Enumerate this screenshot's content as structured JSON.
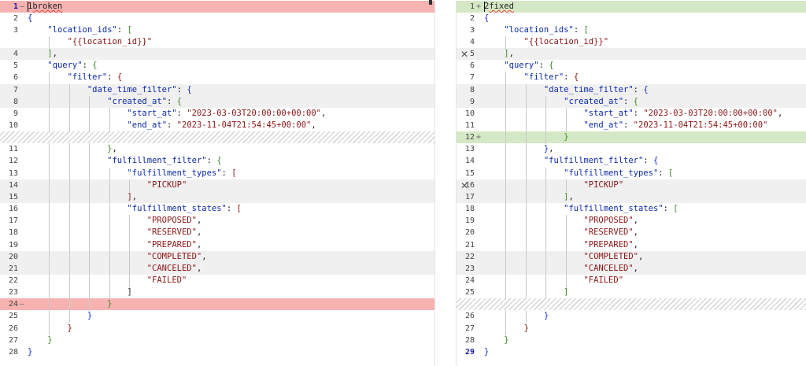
{
  "left": {
    "rows": [
      {
        "num": "1",
        "marker": "—",
        "bg": "removed",
        "current": true,
        "segs": [
          [
            "p",
            "1"
          ],
          [
            "sq",
            "broken"
          ]
        ]
      },
      {
        "num": "2",
        "marker": "",
        "bg": "",
        "segs": [
          [
            "br",
            "{"
          ]
        ]
      },
      {
        "num": "3",
        "marker": "",
        "bg": "",
        "segs": [
          [
            "p",
            "    "
          ],
          [
            "k",
            "\"location_ids\""
          ],
          [
            "p",
            ": "
          ],
          [
            "bl",
            "["
          ]
        ]
      },
      {
        "num": "",
        "marker": "",
        "bg": "",
        "segs": [
          [
            "p",
            "        "
          ],
          [
            "s",
            "\"{{location_id}}\""
          ]
        ]
      },
      {
        "num": "4",
        "marker": "",
        "bg": "changed",
        "segs": [
          [
            "p",
            "    "
          ],
          [
            "bl",
            "]"
          ],
          [
            "p",
            ","
          ]
        ]
      },
      {
        "num": "5",
        "marker": "",
        "bg": "",
        "segs": [
          [
            "p",
            "    "
          ],
          [
            "k",
            "\"query\""
          ],
          [
            "p",
            ": "
          ],
          [
            "bl",
            "{"
          ]
        ]
      },
      {
        "num": "6",
        "marker": "",
        "bg": "",
        "segs": [
          [
            "p",
            "        "
          ],
          [
            "k",
            "\"filter\""
          ],
          [
            "p",
            ": "
          ],
          [
            "s",
            "{"
          ]
        ]
      },
      {
        "num": "7",
        "marker": "",
        "bg": "changed",
        "segs": [
          [
            "p",
            "            "
          ],
          [
            "k",
            "\"date_time_filter\""
          ],
          [
            "p",
            ": "
          ],
          [
            "br",
            "{"
          ]
        ]
      },
      {
        "num": "8",
        "marker": "",
        "bg": "changed",
        "segs": [
          [
            "p",
            "                "
          ],
          [
            "k",
            "\"created_at\""
          ],
          [
            "p",
            ": "
          ],
          [
            "bl",
            "{"
          ]
        ]
      },
      {
        "num": "9",
        "marker": "",
        "bg": "",
        "segs": [
          [
            "p",
            "                    "
          ],
          [
            "k",
            "\"start_at\""
          ],
          [
            "p",
            ": "
          ],
          [
            "s",
            "\"2023-03-03T20:00:00+00:00\""
          ],
          [
            "p",
            ","
          ]
        ]
      },
      {
        "num": "10",
        "marker": "",
        "bg": "",
        "segs": [
          [
            "p",
            "                    "
          ],
          [
            "k",
            "\"end_at\""
          ],
          [
            "p",
            ": "
          ],
          [
            "s",
            "\"2023-11-04T21:54:45+00:00\""
          ],
          [
            "p",
            ","
          ]
        ]
      },
      {
        "num": "",
        "marker": "",
        "bg": "gap",
        "segs": []
      },
      {
        "num": "11",
        "marker": "",
        "bg": "",
        "segs": [
          [
            "p",
            "                "
          ],
          [
            "bl",
            "}"
          ],
          [
            "p",
            ","
          ]
        ]
      },
      {
        "num": "12",
        "marker": "",
        "bg": "",
        "segs": [
          [
            "p",
            "                "
          ],
          [
            "k",
            "\"fulfillment_filter\""
          ],
          [
            "p",
            ": "
          ],
          [
            "bl",
            "{"
          ]
        ]
      },
      {
        "num": "13",
        "marker": "",
        "bg": "",
        "segs": [
          [
            "p",
            "                    "
          ],
          [
            "k",
            "\"fulfillment_types\""
          ],
          [
            "p",
            ": "
          ],
          [
            "s",
            "["
          ]
        ]
      },
      {
        "num": "14",
        "marker": "",
        "bg": "changed",
        "segs": [
          [
            "p",
            "                        "
          ],
          [
            "s",
            "\"PICKUP\""
          ]
        ]
      },
      {
        "num": "15",
        "marker": "",
        "bg": "changed",
        "segs": [
          [
            "p",
            "                    "
          ],
          [
            "s",
            "]"
          ],
          [
            "p",
            ","
          ]
        ]
      },
      {
        "num": "16",
        "marker": "",
        "bg": "",
        "segs": [
          [
            "p",
            "                    "
          ],
          [
            "k",
            "\"fulfillment_states\""
          ],
          [
            "p",
            ": "
          ],
          [
            "s",
            "["
          ]
        ]
      },
      {
        "num": "17",
        "marker": "",
        "bg": "",
        "segs": [
          [
            "p",
            "                        "
          ],
          [
            "s",
            "\"PROPOSED\""
          ],
          [
            "p",
            ","
          ]
        ]
      },
      {
        "num": "18",
        "marker": "",
        "bg": "",
        "segs": [
          [
            "p",
            "                        "
          ],
          [
            "s",
            "\"RESERVED\""
          ],
          [
            "p",
            ","
          ]
        ]
      },
      {
        "num": "19",
        "marker": "",
        "bg": "",
        "segs": [
          [
            "p",
            "                        "
          ],
          [
            "s",
            "\"PREPARED\""
          ],
          [
            "p",
            ","
          ]
        ]
      },
      {
        "num": "20",
        "marker": "",
        "bg": "changed",
        "segs": [
          [
            "p",
            "                        "
          ],
          [
            "s",
            "\"COMPLETED\""
          ],
          [
            "p",
            ","
          ]
        ]
      },
      {
        "num": "21",
        "marker": "",
        "bg": "changed",
        "segs": [
          [
            "p",
            "                        "
          ],
          [
            "s",
            "\"CANCELED\""
          ],
          [
            "p",
            ","
          ]
        ]
      },
      {
        "num": "22",
        "marker": "",
        "bg": "",
        "segs": [
          [
            "p",
            "                        "
          ],
          [
            "s",
            "\"FAILED\""
          ]
        ]
      },
      {
        "num": "23",
        "marker": "",
        "bg": "",
        "segs": [
          [
            "p",
            "                    "
          ],
          [
            "p",
            "]"
          ]
        ]
      },
      {
        "num": "24",
        "marker": "—",
        "bg": "removed",
        "segs": [
          [
            "p",
            "                "
          ],
          [
            "bl",
            "}"
          ]
        ]
      },
      {
        "num": "25",
        "marker": "",
        "bg": "",
        "segs": [
          [
            "p",
            "            "
          ],
          [
            "br",
            "}"
          ]
        ]
      },
      {
        "num": "26",
        "marker": "",
        "bg": "",
        "segs": [
          [
            "p",
            "        "
          ],
          [
            "s",
            "}"
          ]
        ]
      },
      {
        "num": "27",
        "marker": "",
        "bg": "",
        "segs": [
          [
            "p",
            "    "
          ],
          [
            "bl",
            "}"
          ]
        ]
      },
      {
        "num": "28",
        "marker": "",
        "bg": "",
        "segs": [
          [
            "br",
            "}"
          ]
        ]
      }
    ]
  },
  "right": {
    "rows": [
      {
        "num": "1",
        "marker": "+",
        "bg": "added",
        "segs": [
          [
            "p",
            "2"
          ],
          [
            "sq",
            "fixed"
          ]
        ]
      },
      {
        "num": "2",
        "marker": "",
        "bg": "",
        "segs": [
          [
            "br",
            "{"
          ]
        ]
      },
      {
        "num": "3",
        "marker": "",
        "bg": "",
        "segs": [
          [
            "p",
            "    "
          ],
          [
            "k",
            "\"location_ids\""
          ],
          [
            "p",
            ": "
          ],
          [
            "bl",
            "["
          ]
        ]
      },
      {
        "num": "4",
        "marker": "",
        "bg": "",
        "segs": [
          [
            "p",
            "        "
          ],
          [
            "s",
            "\"{{location_id}}\""
          ]
        ]
      },
      {
        "num": "5",
        "marker": "",
        "bg": "changed",
        "segs": [
          [
            "p",
            "    "
          ],
          [
            "bl",
            "]"
          ],
          [
            "p",
            ","
          ]
        ]
      },
      {
        "num": "6",
        "marker": "",
        "bg": "",
        "segs": [
          [
            "p",
            "    "
          ],
          [
            "k",
            "\"query\""
          ],
          [
            "p",
            ": "
          ],
          [
            "bl",
            "{"
          ]
        ]
      },
      {
        "num": "7",
        "marker": "",
        "bg": "",
        "segs": [
          [
            "p",
            "        "
          ],
          [
            "k",
            "\"filter\""
          ],
          [
            "p",
            ": "
          ],
          [
            "s",
            "{"
          ]
        ]
      },
      {
        "num": "8",
        "marker": "",
        "bg": "changed",
        "segs": [
          [
            "p",
            "            "
          ],
          [
            "k",
            "\"date_time_filter\""
          ],
          [
            "p",
            ": "
          ],
          [
            "br",
            "{"
          ]
        ]
      },
      {
        "num": "9",
        "marker": "",
        "bg": "changed",
        "segs": [
          [
            "p",
            "                "
          ],
          [
            "k",
            "\"created_at\""
          ],
          [
            "p",
            ": "
          ],
          [
            "bl",
            "{"
          ]
        ]
      },
      {
        "num": "10",
        "marker": "",
        "bg": "",
        "segs": [
          [
            "p",
            "                    "
          ],
          [
            "k",
            "\"start_at\""
          ],
          [
            "p",
            ": "
          ],
          [
            "s",
            "\"2023-03-03T20:00:00+00:00\""
          ],
          [
            "p",
            ","
          ]
        ]
      },
      {
        "num": "11",
        "marker": "",
        "bg": "",
        "segs": [
          [
            "p",
            "                    "
          ],
          [
            "k",
            "\"end_at\""
          ],
          [
            "p",
            ": "
          ],
          [
            "s",
            "\"2023-11-04T21:54:45+00:00\""
          ]
        ]
      },
      {
        "num": "12",
        "marker": "+",
        "bg": "added",
        "segs": [
          [
            "p",
            "                "
          ],
          [
            "bl",
            "}"
          ]
        ]
      },
      {
        "num": "13",
        "marker": "",
        "bg": "",
        "segs": [
          [
            "p",
            "            "
          ],
          [
            "br",
            "}"
          ],
          [
            "p",
            ","
          ]
        ]
      },
      {
        "num": "14",
        "marker": "",
        "bg": "",
        "segs": [
          [
            "p",
            "            "
          ],
          [
            "k",
            "\"fulfillment_filter\""
          ],
          [
            "p",
            ": "
          ],
          [
            "br",
            "{"
          ]
        ]
      },
      {
        "num": "15",
        "marker": "",
        "bg": "",
        "segs": [
          [
            "p",
            "                "
          ],
          [
            "k",
            "\"fulfillment_types\""
          ],
          [
            "p",
            ": "
          ],
          [
            "bl",
            "["
          ]
        ]
      },
      {
        "num": "16",
        "marker": "",
        "bg": "changed",
        "segs": [
          [
            "p",
            "                    "
          ],
          [
            "s",
            "\"PICKUP\""
          ]
        ]
      },
      {
        "num": "17",
        "marker": "",
        "bg": "changed",
        "segs": [
          [
            "p",
            "                "
          ],
          [
            "bl",
            "]"
          ],
          [
            "p",
            ","
          ]
        ]
      },
      {
        "num": "18",
        "marker": "",
        "bg": "",
        "segs": [
          [
            "p",
            "                "
          ],
          [
            "k",
            "\"fulfillment_states\""
          ],
          [
            "p",
            ": "
          ],
          [
            "bl",
            "["
          ]
        ]
      },
      {
        "num": "19",
        "marker": "",
        "bg": "",
        "segs": [
          [
            "p",
            "                    "
          ],
          [
            "s",
            "\"PROPOSED\""
          ],
          [
            "p",
            ","
          ]
        ]
      },
      {
        "num": "20",
        "marker": "",
        "bg": "",
        "segs": [
          [
            "p",
            "                    "
          ],
          [
            "s",
            "\"RESERVED\""
          ],
          [
            "p",
            ","
          ]
        ]
      },
      {
        "num": "21",
        "marker": "",
        "bg": "",
        "segs": [
          [
            "p",
            "                    "
          ],
          [
            "s",
            "\"PREPARED\""
          ],
          [
            "p",
            ","
          ]
        ]
      },
      {
        "num": "22",
        "marker": "",
        "bg": "changed",
        "segs": [
          [
            "p",
            "                    "
          ],
          [
            "s",
            "\"COMPLETED\""
          ],
          [
            "p",
            ","
          ]
        ]
      },
      {
        "num": "23",
        "marker": "",
        "bg": "changed",
        "segs": [
          [
            "p",
            "                    "
          ],
          [
            "s",
            "\"CANCELED\""
          ],
          [
            "p",
            ","
          ]
        ]
      },
      {
        "num": "24",
        "marker": "",
        "bg": "",
        "segs": [
          [
            "p",
            "                    "
          ],
          [
            "s",
            "\"FAILED\""
          ]
        ]
      },
      {
        "num": "25",
        "marker": "",
        "bg": "",
        "segs": [
          [
            "p",
            "                "
          ],
          [
            "bl",
            "]"
          ]
        ]
      },
      {
        "num": "",
        "marker": "",
        "bg": "gap",
        "segs": []
      },
      {
        "num": "26",
        "marker": "",
        "bg": "",
        "segs": [
          [
            "p",
            "            "
          ],
          [
            "br",
            "}"
          ]
        ]
      },
      {
        "num": "27",
        "marker": "",
        "bg": "",
        "segs": [
          [
            "p",
            "        "
          ],
          [
            "s",
            "}"
          ]
        ]
      },
      {
        "num": "28",
        "marker": "",
        "bg": "",
        "segs": [
          [
            "p",
            "    "
          ],
          [
            "bl",
            "}"
          ]
        ]
      },
      {
        "num": "29",
        "marker": "",
        "bg": "",
        "current": true,
        "segs": [
          [
            "br",
            "}"
          ]
        ]
      }
    ]
  },
  "gutter": {
    "revert_buttons": [
      {
        "label": "✕",
        "row": 4
      },
      {
        "label": "✕",
        "row": 15
      }
    ]
  },
  "colors": {
    "removed": "#f7b3b1",
    "added": "#d5e8c5",
    "changed": "#f0f0f0",
    "key": "#0b2aa8",
    "string": "#8a1515",
    "bracket_green": "#3b8a27",
    "bracket_blue": "#1a2bd0"
  }
}
